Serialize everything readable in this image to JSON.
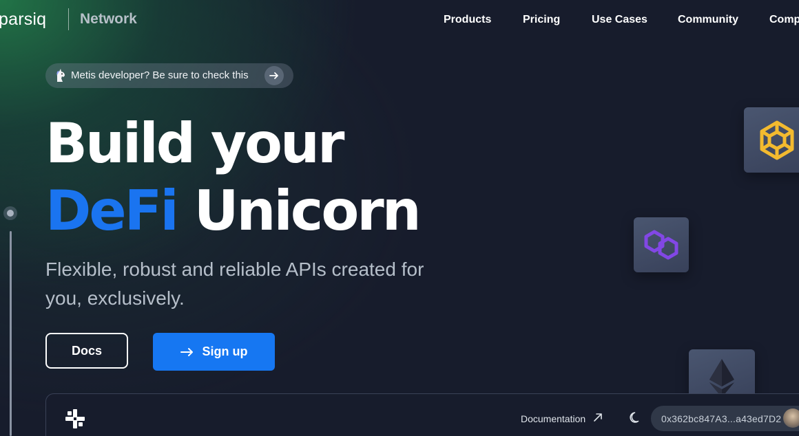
{
  "brand": {
    "logo_text": "parsiq",
    "product": "Network"
  },
  "nav": {
    "links": [
      {
        "label": "Products"
      },
      {
        "label": "Pricing"
      },
      {
        "label": "Use Cases"
      },
      {
        "label": "Community"
      },
      {
        "label": "Comp"
      }
    ]
  },
  "announcement": {
    "text": "Metis developer? Be sure to check this",
    "icon": "unicorn-emoji-icon",
    "arrow_icon": "arrow-right-icon"
  },
  "hero": {
    "line1": "Build your",
    "accent": "DeFi",
    "line2_rest": " Unicorn",
    "subtitle": "Flexible, robust and reliable APIs created for you, exclusively.",
    "accent_color": "#1a74f0"
  },
  "buttons": {
    "docs": "Docs",
    "signup": "Sign up",
    "signup_color": "#1677f2"
  },
  "chains": [
    {
      "name": "bnb-chain-icon"
    },
    {
      "name": "polygon-icon"
    },
    {
      "name": "ethereum-icon"
    }
  ],
  "dashboard": {
    "documentation": "Documentation",
    "wallet_address": "0x362bc847A3...a43ed7D2",
    "theme_icon": "moon-icon"
  }
}
